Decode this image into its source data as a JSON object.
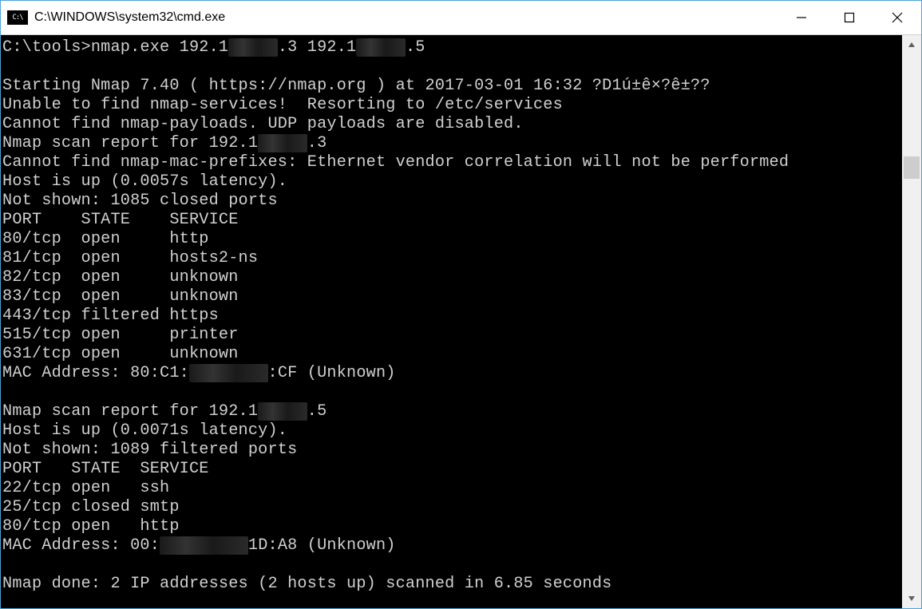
{
  "window": {
    "title": "C:\\WINDOWS\\system32\\cmd.exe",
    "icon_label": "C:\\"
  },
  "prompt": {
    "path": "C:\\tools>",
    "cmd_prefix": "nmap.exe 192.1",
    "cmd_red1": "68.1 ",
    "cmd_mid": ".3 192.1",
    "cmd_red2": "68.1 ",
    "cmd_end": ".5"
  },
  "out": {
    "l1a": "Starting Nmap 7.40 ( https://nmap.org ) at 2017-03-01 16:32 ?D1ú±ê×?ê±??",
    "l2": "Unable to find nmap-services!  Resorting to /etc/services",
    "l3": "Cannot find nmap-payloads. UDP payloads are disabled.",
    "l4a": "Nmap scan report for 192.1",
    "l4r": "68.10",
    "l4b": ".3",
    "l5": "Cannot find nmap-mac-prefixes: Ethernet vendor correlation will not be performed",
    "l6": "Host is up (0.0057s latency).",
    "l7": "Not shown: 1085 closed ports",
    "h1": "PORT    STATE    SERVICE",
    "p1": "80/tcp  open     http",
    "p2": "81/tcp  open     hosts2-ns",
    "p3": "82/tcp  open     unknown",
    "p4": "83/tcp  open     unknown",
    "p5": "443/tcp filtered https",
    "p6": "515/tcp open     printer",
    "p7": "631/tcp open     unknown",
    "m1a": "MAC Address: 80:C1:",
    "m1r": "6E:2F:D3",
    "m1b": ":CF (Unknown)",
    "s2a": "Nmap scan report for 192.1",
    "s2r": "68.10",
    "s2b": ".5",
    "s2l1": "Host is up (0.0071s latency).",
    "s2l2": "Not shown: 1089 filtered ports",
    "h2": "PORT   STATE  SERVICE",
    "q1": "22/tcp open   ssh",
    "q2": "25/tcp closed smtp",
    "q3": "80/tcp open   http",
    "m2a": "MAC Address: 00:",
    "m2r": "0C:29:4E:",
    "m2b": "1D:A8 (Unknown)",
    "done": "Nmap done: 2 IP addresses (2 hosts up) scanned in 6.85 seconds"
  }
}
